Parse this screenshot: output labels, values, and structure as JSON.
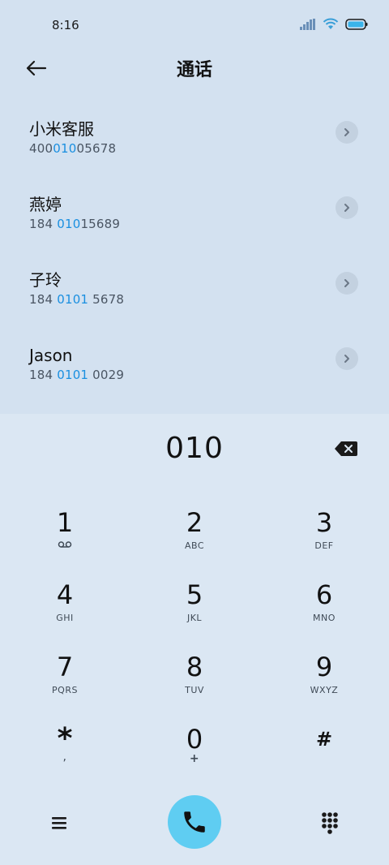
{
  "status": {
    "time": "8:16"
  },
  "header": {
    "title": "通话"
  },
  "contacts": [
    {
      "name": "小米客服",
      "num_pre": "400",
      "num_hl": "010",
      "num_post": "05678"
    },
    {
      "name": "燕婷",
      "num_pre": "184 ",
      "num_hl": "010",
      "num_post": "15689"
    },
    {
      "name": "子玲",
      "num_pre": "184 ",
      "num_hl": "0101",
      "num_post": " 5678"
    },
    {
      "name": "Jason",
      "num_pre": "184 ",
      "num_hl": "0101",
      "num_post": " 0029"
    }
  ],
  "dialpad": {
    "input": "010",
    "keys": [
      {
        "digit": "1",
        "sub": ""
      },
      {
        "digit": "2",
        "sub": "ABC"
      },
      {
        "digit": "3",
        "sub": "DEF"
      },
      {
        "digit": "4",
        "sub": "GHI"
      },
      {
        "digit": "5",
        "sub": "JKL"
      },
      {
        "digit": "6",
        "sub": "MNO"
      },
      {
        "digit": "7",
        "sub": "PQRS"
      },
      {
        "digit": "8",
        "sub": "TUV"
      },
      {
        "digit": "9",
        "sub": "WXYZ"
      },
      {
        "digit": "*",
        "sub": ","
      },
      {
        "digit": "0",
        "sub": "+"
      },
      {
        "digit": "#",
        "sub": ""
      }
    ]
  },
  "icons": {
    "back": "arrow-left-icon",
    "chevron": "chevron-right-icon",
    "backspace": "backspace-icon",
    "voicemail": "voicemail-icon",
    "menu": "menu-icon",
    "call": "phone-icon",
    "dialpad": "dialpad-grid-icon"
  },
  "colors": {
    "accent": "#1a8fe0",
    "call_button": "#5fcdf2",
    "background": "#d3e1f0"
  }
}
